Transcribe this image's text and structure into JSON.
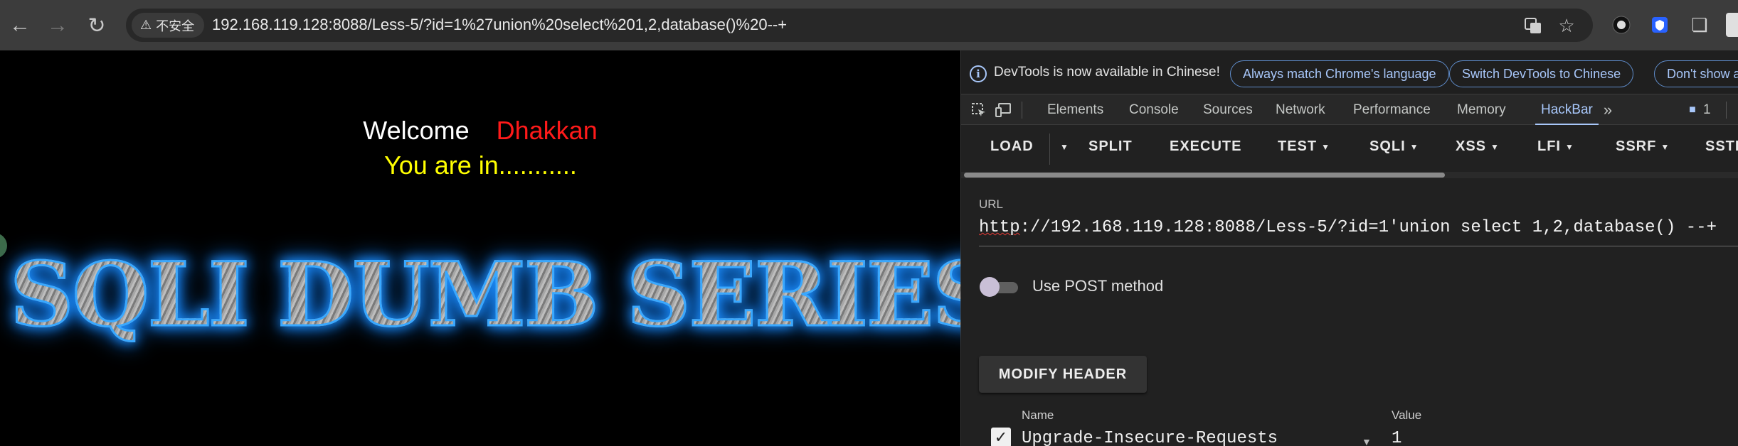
{
  "browser": {
    "security_label": "不安全",
    "url": "192.168.119.128:8088/Less-5/?id=1%27union%20select%201,2,database()%20--+"
  },
  "page": {
    "welcome": "Welcome",
    "name": "Dhakkan",
    "status": "You are in...........",
    "banner": "SQLI DUMB SERIES"
  },
  "devtools": {
    "info_text": "DevTools is now available in Chinese!",
    "pills": [
      "Always match Chrome's language",
      "Switch DevTools to Chinese",
      "Don't show a"
    ],
    "tabs": [
      "Elements",
      "Console",
      "Sources",
      "Network",
      "Performance",
      "Memory",
      "HackBar"
    ],
    "active_tab": "HackBar",
    "issues_count": "1"
  },
  "hackbar": {
    "buttons": [
      "LOAD",
      "SPLIT",
      "EXECUTE",
      "TEST",
      "SQLI",
      "XSS",
      "LFI",
      "SSRF",
      "SSTI"
    ],
    "url_label": "URL",
    "url_scheme": "http",
    "url_rest": "://192.168.119.128:8088/Less-5/?id=1'union select 1,2,database() --+",
    "post_label": "Use POST method",
    "post_enabled": false,
    "modify_header_label": "MODIFY HEADER",
    "header_col_name": "Name",
    "header_col_value": "Value",
    "header_row": {
      "name": "Upgrade-Insecure-Requests",
      "value": "1",
      "enabled": true
    }
  },
  "colors": {
    "welcome_name": "#ff1a1a",
    "status_text": "#ffff00",
    "banner_glow": "#1e90ff",
    "accent": "#a8c7fa"
  }
}
